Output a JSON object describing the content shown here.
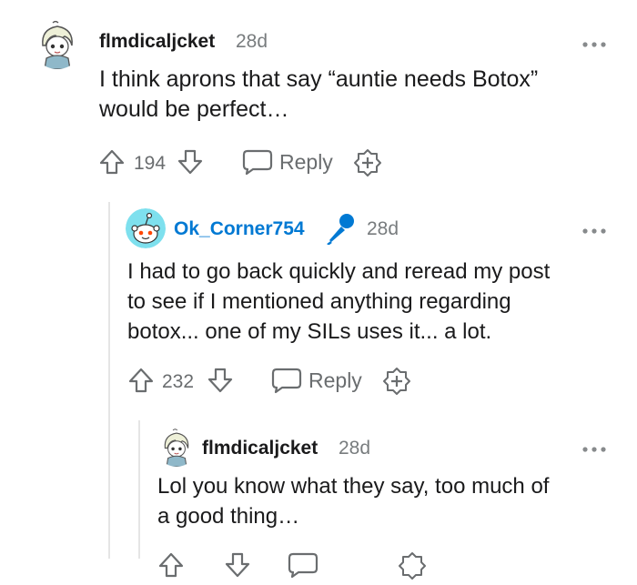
{
  "comments": [
    {
      "username": "flmdicaljcket",
      "time": "28d",
      "body_lines": [
        "I think aprons that say “auntie needs Botox”",
        "would be perfect…"
      ],
      "votes": "194",
      "reply_label": "Reply",
      "avatar_icon": "anime-character-avatar-icon"
    },
    {
      "username": "Ok_Corner754",
      "time": "28d",
      "badge_icon": "microphone-icon",
      "body_lines": [
        "I had to go back quickly and reread my post",
        "to see if I mentioned anything regarding",
        "botox... one of my SILs uses it... a lot."
      ],
      "votes": "232",
      "reply_label": "Reply",
      "avatar_icon": "snoo-avatar-icon"
    },
    {
      "username": "flmdicaljcket",
      "time": "28d",
      "body_lines": [
        "Lol you know what they say, too much of",
        "a good thing…"
      ],
      "avatar_icon": "anime-character-avatar-icon"
    }
  ],
  "colors": {
    "username_highlight": "#0079d3",
    "meta_gray": "#787c7e",
    "thread_line": "#e5e5e5"
  }
}
